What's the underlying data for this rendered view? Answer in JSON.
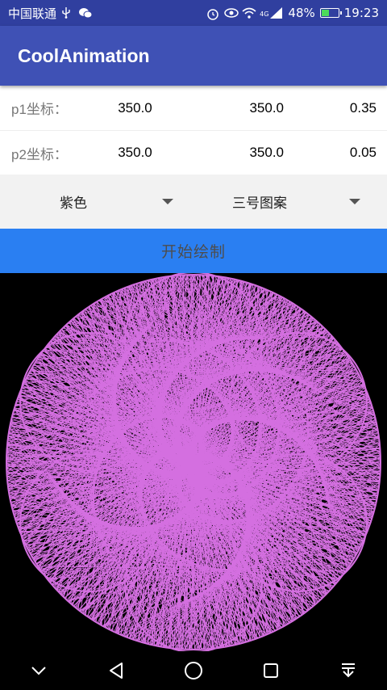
{
  "status_bar": {
    "carrier": "中国联通",
    "battery_percent": "48%",
    "battery_level": 0.48,
    "time": "19:23",
    "network": "4G",
    "icons_left": [
      "usb-icon",
      "wechat-icon"
    ],
    "icons_right": [
      "alarm-icon",
      "eye-icon",
      "wifi-icon",
      "signal-icon",
      "battery-icon"
    ]
  },
  "app_bar": {
    "title": "CoolAnimation"
  },
  "params": [
    {
      "label": "p1坐标：",
      "x": "350.0",
      "y": "350.0",
      "ratio": "0.35"
    },
    {
      "label": "p2坐标：",
      "x": "350.0",
      "y": "350.0",
      "ratio": "0.05"
    }
  ],
  "selects": {
    "color": {
      "value": "紫色"
    },
    "pattern": {
      "value": "三号图案"
    }
  },
  "start_button": {
    "label": "开始绘制"
  },
  "drawing": {
    "stroke_color": "#D46FE0",
    "background": "#000000"
  },
  "colors": {
    "status_bar": "#303F9F",
    "app_bar": "#3F51B5",
    "button": "#2A7FF2"
  },
  "nav_bar": {
    "icons": [
      "chevron-down-icon",
      "back-icon",
      "home-icon",
      "recents-icon",
      "notification-pull-icon"
    ]
  }
}
